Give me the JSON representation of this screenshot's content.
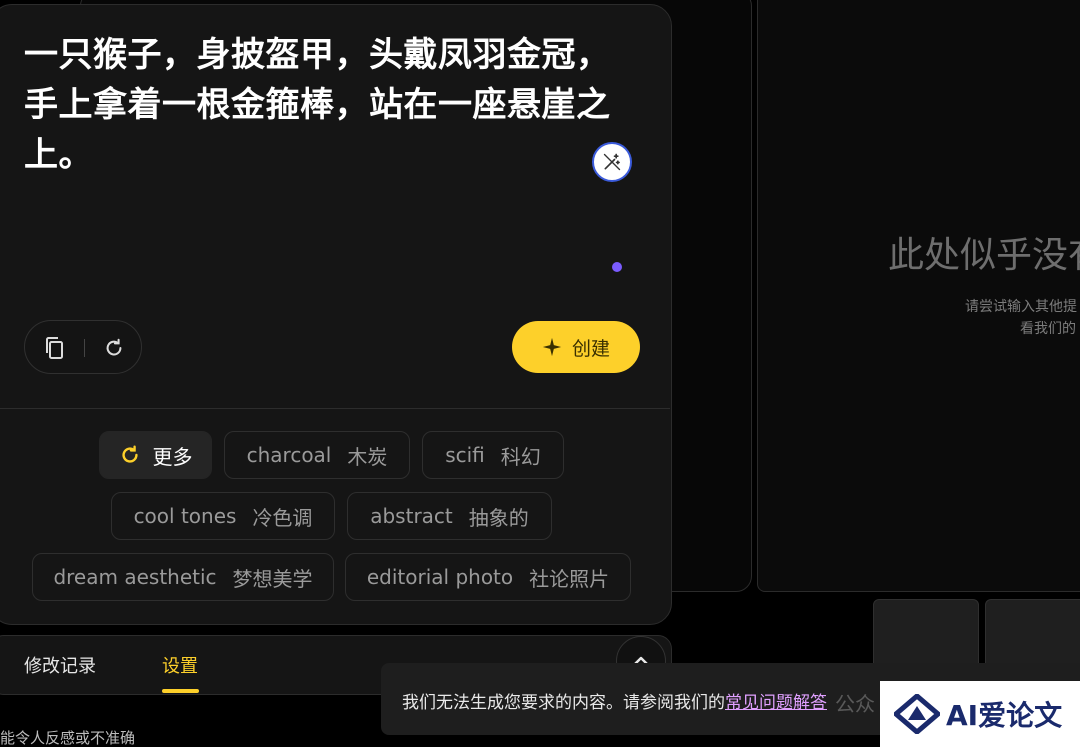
{
  "prompt": {
    "text": "一只猴子，身披盔甲，头戴凤羽金冠，手上拿着一根金箍棒，站在一座悬崖之上。"
  },
  "actions": {
    "create_label": "创建"
  },
  "chips": {
    "more_label": "更多",
    "items": [
      {
        "en": "charcoal",
        "zh": "木炭"
      },
      {
        "en": "scifi",
        "zh": "科幻"
      },
      {
        "en": "cool tones",
        "zh": "冷色调"
      },
      {
        "en": "abstract",
        "zh": "抽象的"
      },
      {
        "en": "dream aesthetic",
        "zh": "梦想美学"
      },
      {
        "en": "editorial photo",
        "zh": "社论照片"
      }
    ]
  },
  "tabs": {
    "history": "修改记录",
    "settings": "设置"
  },
  "empty_state": {
    "title": "此处似乎没有",
    "line1": "请尝试输入其他提",
    "line2": "看我们的"
  },
  "footer": {
    "note": "能令人反感或不准确"
  },
  "toast": {
    "text": "我们无法生成您要求的内容。请参阅我们的",
    "link": "常见问题解答"
  },
  "watermark": {
    "text": "公众",
    "logo": "AI爱论文"
  },
  "colors": {
    "accent": "#fdd02a",
    "link": "#e0a0ff",
    "dot": "#7b5cff"
  }
}
